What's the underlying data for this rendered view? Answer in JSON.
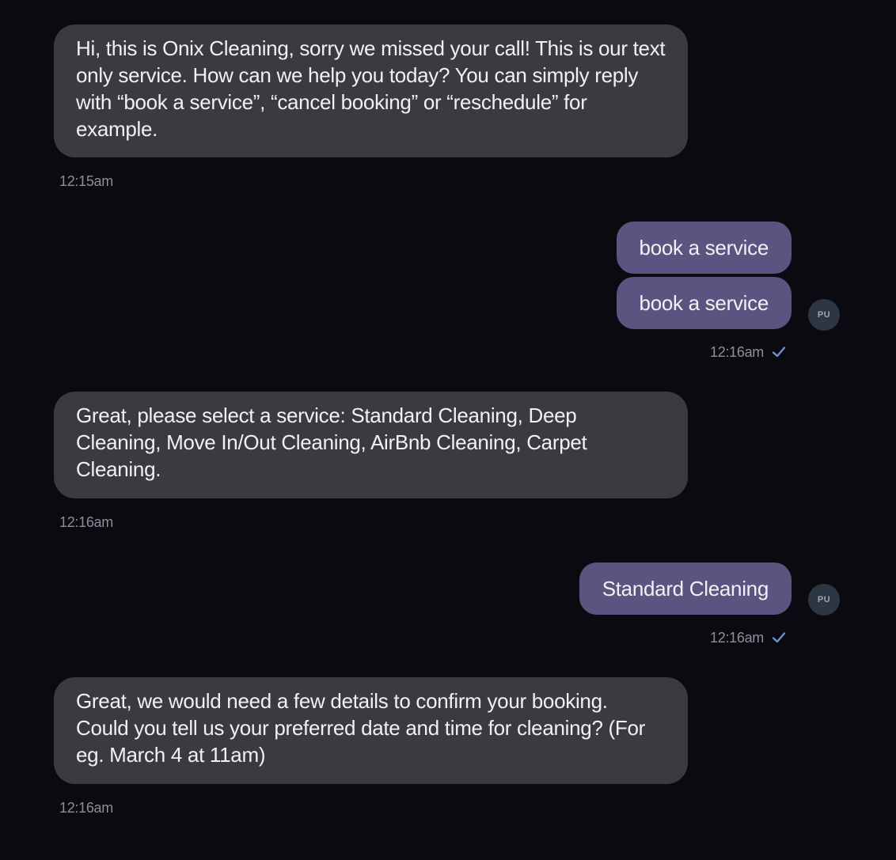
{
  "conversation": {
    "messages": [
      {
        "direction": "incoming",
        "text": "Hi, this is Onix Cleaning, sorry we missed your call! This is our text only service. How can we help you today? You can simply reply with “book a service”, “cancel booking” or “reschedule” for example.",
        "time": "12:15am"
      },
      {
        "direction": "outgoing",
        "texts": [
          "book a service",
          "book a service"
        ],
        "time": "12:16am",
        "avatar_initials": "PU",
        "status_icon": "checkmark-icon"
      },
      {
        "direction": "incoming",
        "text": "Great, please select a service: Standard Cleaning, Deep Cleaning, Move In/Out Cleaning, AirBnb Cleaning, Carpet Cleaning.",
        "time": "12:16am"
      },
      {
        "direction": "outgoing",
        "texts": [
          "Standard Cleaning"
        ],
        "time": "12:16am",
        "avatar_initials": "PU",
        "status_icon": "checkmark-icon"
      },
      {
        "direction": "incoming",
        "text": "Great, we would need a few details to confirm your booking. Could you tell us your preferred date and time for cleaning? (For eg. March 4 at 11am)",
        "time": "12:16am"
      }
    ]
  },
  "colors": {
    "background": "#0b0a10",
    "incoming_bubble": "#3b3b3f",
    "outgoing_bubble": "#5a5480",
    "timestamp": "#8d8e99",
    "check": "#6f8fd8"
  }
}
